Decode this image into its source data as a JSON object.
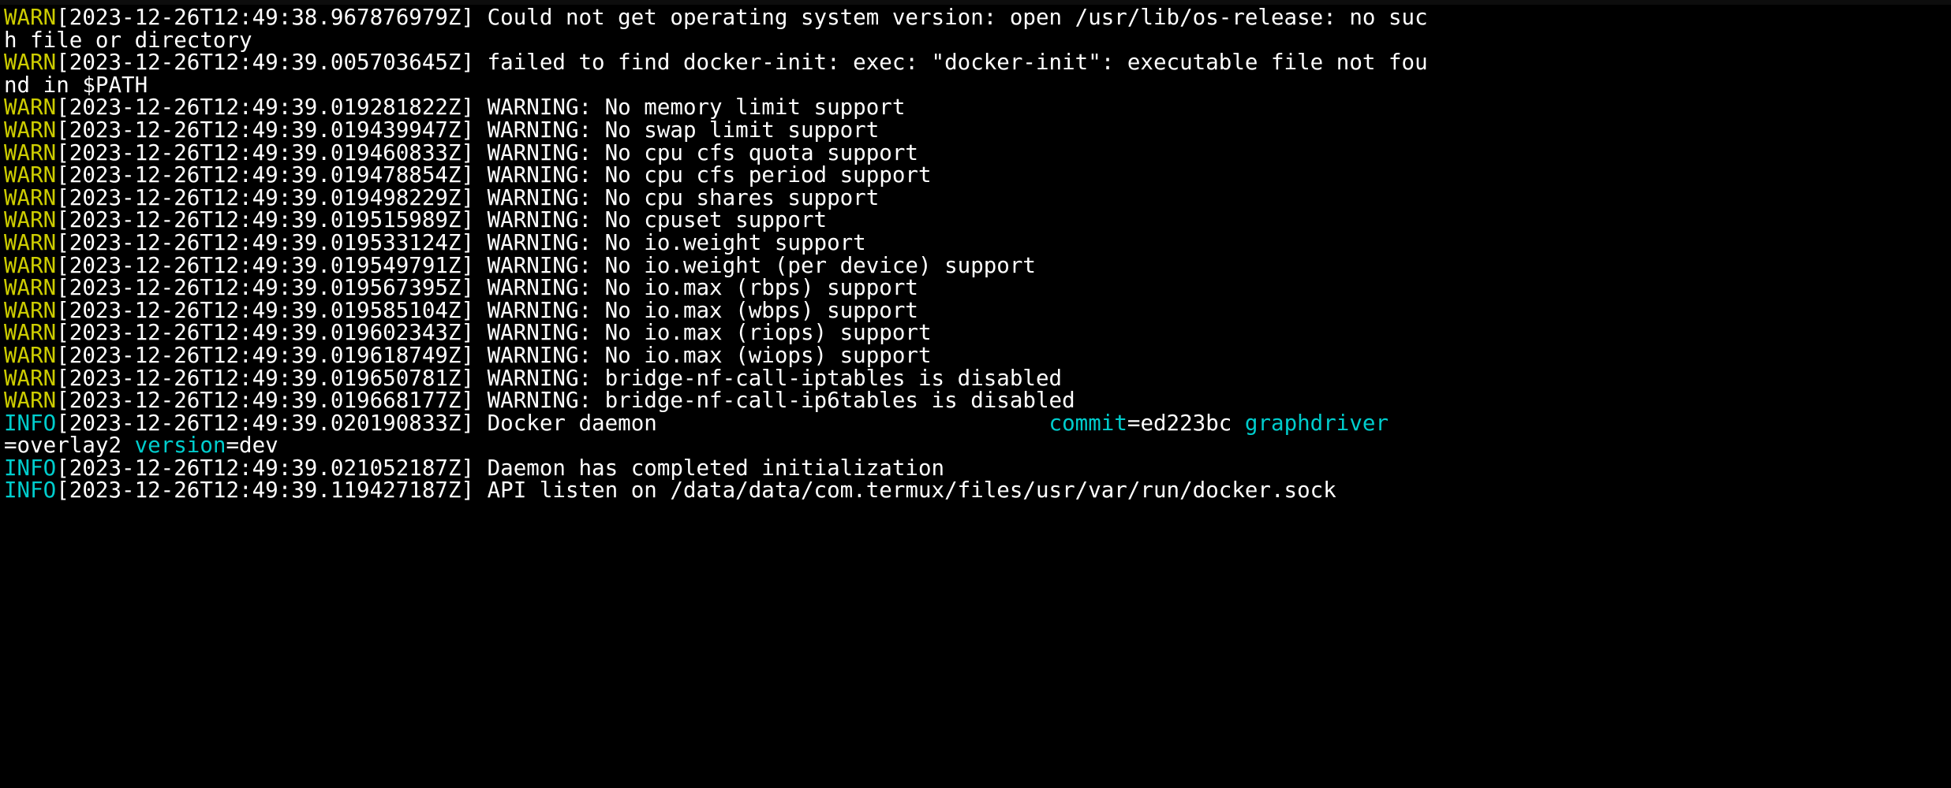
{
  "terminal": {
    "app": "termux-terminal",
    "program": "dockerd",
    "colors": {
      "background": "#000000",
      "foreground": "#ffffff",
      "warn": "#cdcd00",
      "info": "#00cdcd",
      "field_key": "#00cdcd",
      "top_bar": "#0d0d0d"
    },
    "columns": 86,
    "rows": 22
  },
  "log_lines": [
    {
      "level": "WARN",
      "timestamp": "[2023-12-26T12:49:38.967876979Z]",
      "message": " Could not get operating system version: open /usr/lib/os-release: no suc",
      "continuation": "h file or directory",
      "fields": []
    },
    {
      "level": "WARN",
      "timestamp": "[2023-12-26T12:49:39.005703645Z]",
      "message": " failed to find docker-init: exec: \"docker-init\": executable file not fou",
      "continuation": "nd in $PATH",
      "fields": []
    },
    {
      "level": "WARN",
      "timestamp": "[2023-12-26T12:49:39.019281822Z]",
      "message": " WARNING: No memory limit support",
      "continuation": null,
      "fields": []
    },
    {
      "level": "WARN",
      "timestamp": "[2023-12-26T12:49:39.019439947Z]",
      "message": " WARNING: No swap limit support",
      "continuation": null,
      "fields": []
    },
    {
      "level": "WARN",
      "timestamp": "[2023-12-26T12:49:39.019460833Z]",
      "message": " WARNING: No cpu cfs quota support",
      "continuation": null,
      "fields": []
    },
    {
      "level": "WARN",
      "timestamp": "[2023-12-26T12:49:39.019478854Z]",
      "message": " WARNING: No cpu cfs period support",
      "continuation": null,
      "fields": []
    },
    {
      "level": "WARN",
      "timestamp": "[2023-12-26T12:49:39.019498229Z]",
      "message": " WARNING: No cpu shares support",
      "continuation": null,
      "fields": []
    },
    {
      "level": "WARN",
      "timestamp": "[2023-12-26T12:49:39.019515989Z]",
      "message": " WARNING: No cpuset support",
      "continuation": null,
      "fields": []
    },
    {
      "level": "WARN",
      "timestamp": "[2023-12-26T12:49:39.019533124Z]",
      "message": " WARNING: No io.weight support",
      "continuation": null,
      "fields": []
    },
    {
      "level": "WARN",
      "timestamp": "[2023-12-26T12:49:39.019549791Z]",
      "message": " WARNING: No io.weight (per device) support",
      "continuation": null,
      "fields": []
    },
    {
      "level": "WARN",
      "timestamp": "[2023-12-26T12:49:39.019567395Z]",
      "message": " WARNING: No io.max (rbps) support",
      "continuation": null,
      "fields": []
    },
    {
      "level": "WARN",
      "timestamp": "[2023-12-26T12:49:39.019585104Z]",
      "message": " WARNING: No io.max (wbps) support",
      "continuation": null,
      "fields": []
    },
    {
      "level": "WARN",
      "timestamp": "[2023-12-26T12:49:39.019602343Z]",
      "message": " WARNING: No io.max (riops) support",
      "continuation": null,
      "fields": []
    },
    {
      "level": "WARN",
      "timestamp": "[2023-12-26T12:49:39.019618749Z]",
      "message": " WARNING: No io.max (wiops) support",
      "continuation": null,
      "fields": []
    },
    {
      "level": "WARN",
      "timestamp": "[2023-12-26T12:49:39.019650781Z]",
      "message": " WARNING: bridge-nf-call-iptables is disabled",
      "continuation": null,
      "fields": []
    },
    {
      "level": "WARN",
      "timestamp": "[2023-12-26T12:49:39.019668177Z]",
      "message": " WARNING: bridge-nf-call-ip6tables is disabled",
      "continuation": null,
      "fields": []
    },
    {
      "level": "INFO",
      "timestamp": "[2023-12-26T12:49:39.020190833Z]",
      "message": " Docker daemon",
      "pad": "                              ",
      "continuation": null,
      "fields": [
        {
          "key": "commit",
          "value": "=ed223bc"
        },
        {
          "key": " graphdriver",
          "value": ""
        }
      ],
      "wrapped_fields": [
        {
          "key": "",
          "value": "=overlay2 "
        },
        {
          "key": "version",
          "value": "=dev"
        }
      ]
    },
    {
      "level": "INFO",
      "timestamp": "[2023-12-26T12:49:39.021052187Z]",
      "message": " Daemon has completed initialization",
      "continuation": null,
      "fields": []
    },
    {
      "level": "INFO",
      "timestamp": "[2023-12-26T12:49:39.119427187Z]",
      "message": " API listen on /data/data/com.termux/files/usr/var/run/docker.sock",
      "continuation": null,
      "fields": []
    }
  ]
}
